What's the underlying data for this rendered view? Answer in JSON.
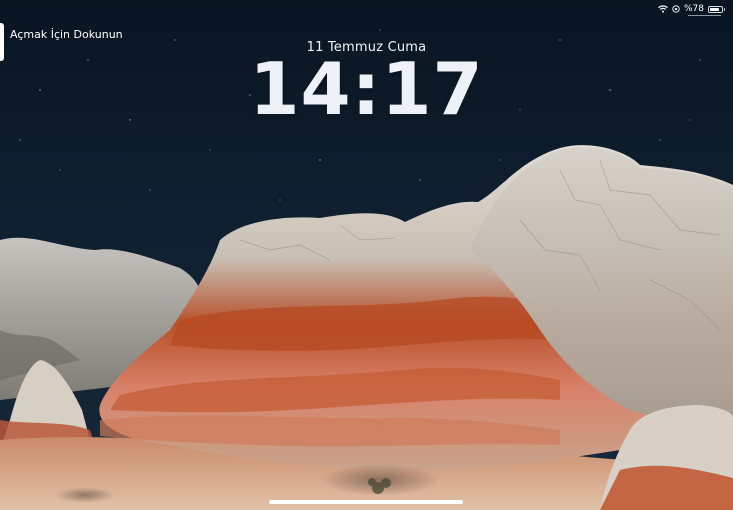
{
  "status_bar": {
    "battery_text": "%78",
    "battery_level": 0.78,
    "icons": [
      "wifi-icon",
      "orientation-lock-icon",
      "battery-icon"
    ]
  },
  "accessibility": {
    "unlock_hint": "Açmak İçin Dokunun"
  },
  "lock_screen": {
    "date": "11 Temmuz Cuma",
    "time": "14:17"
  },
  "colors": {
    "sky": "#0b1826",
    "rock_light": "#d8d2c8",
    "rock_orange": "#c2562a",
    "text": "#f2f4f8"
  }
}
